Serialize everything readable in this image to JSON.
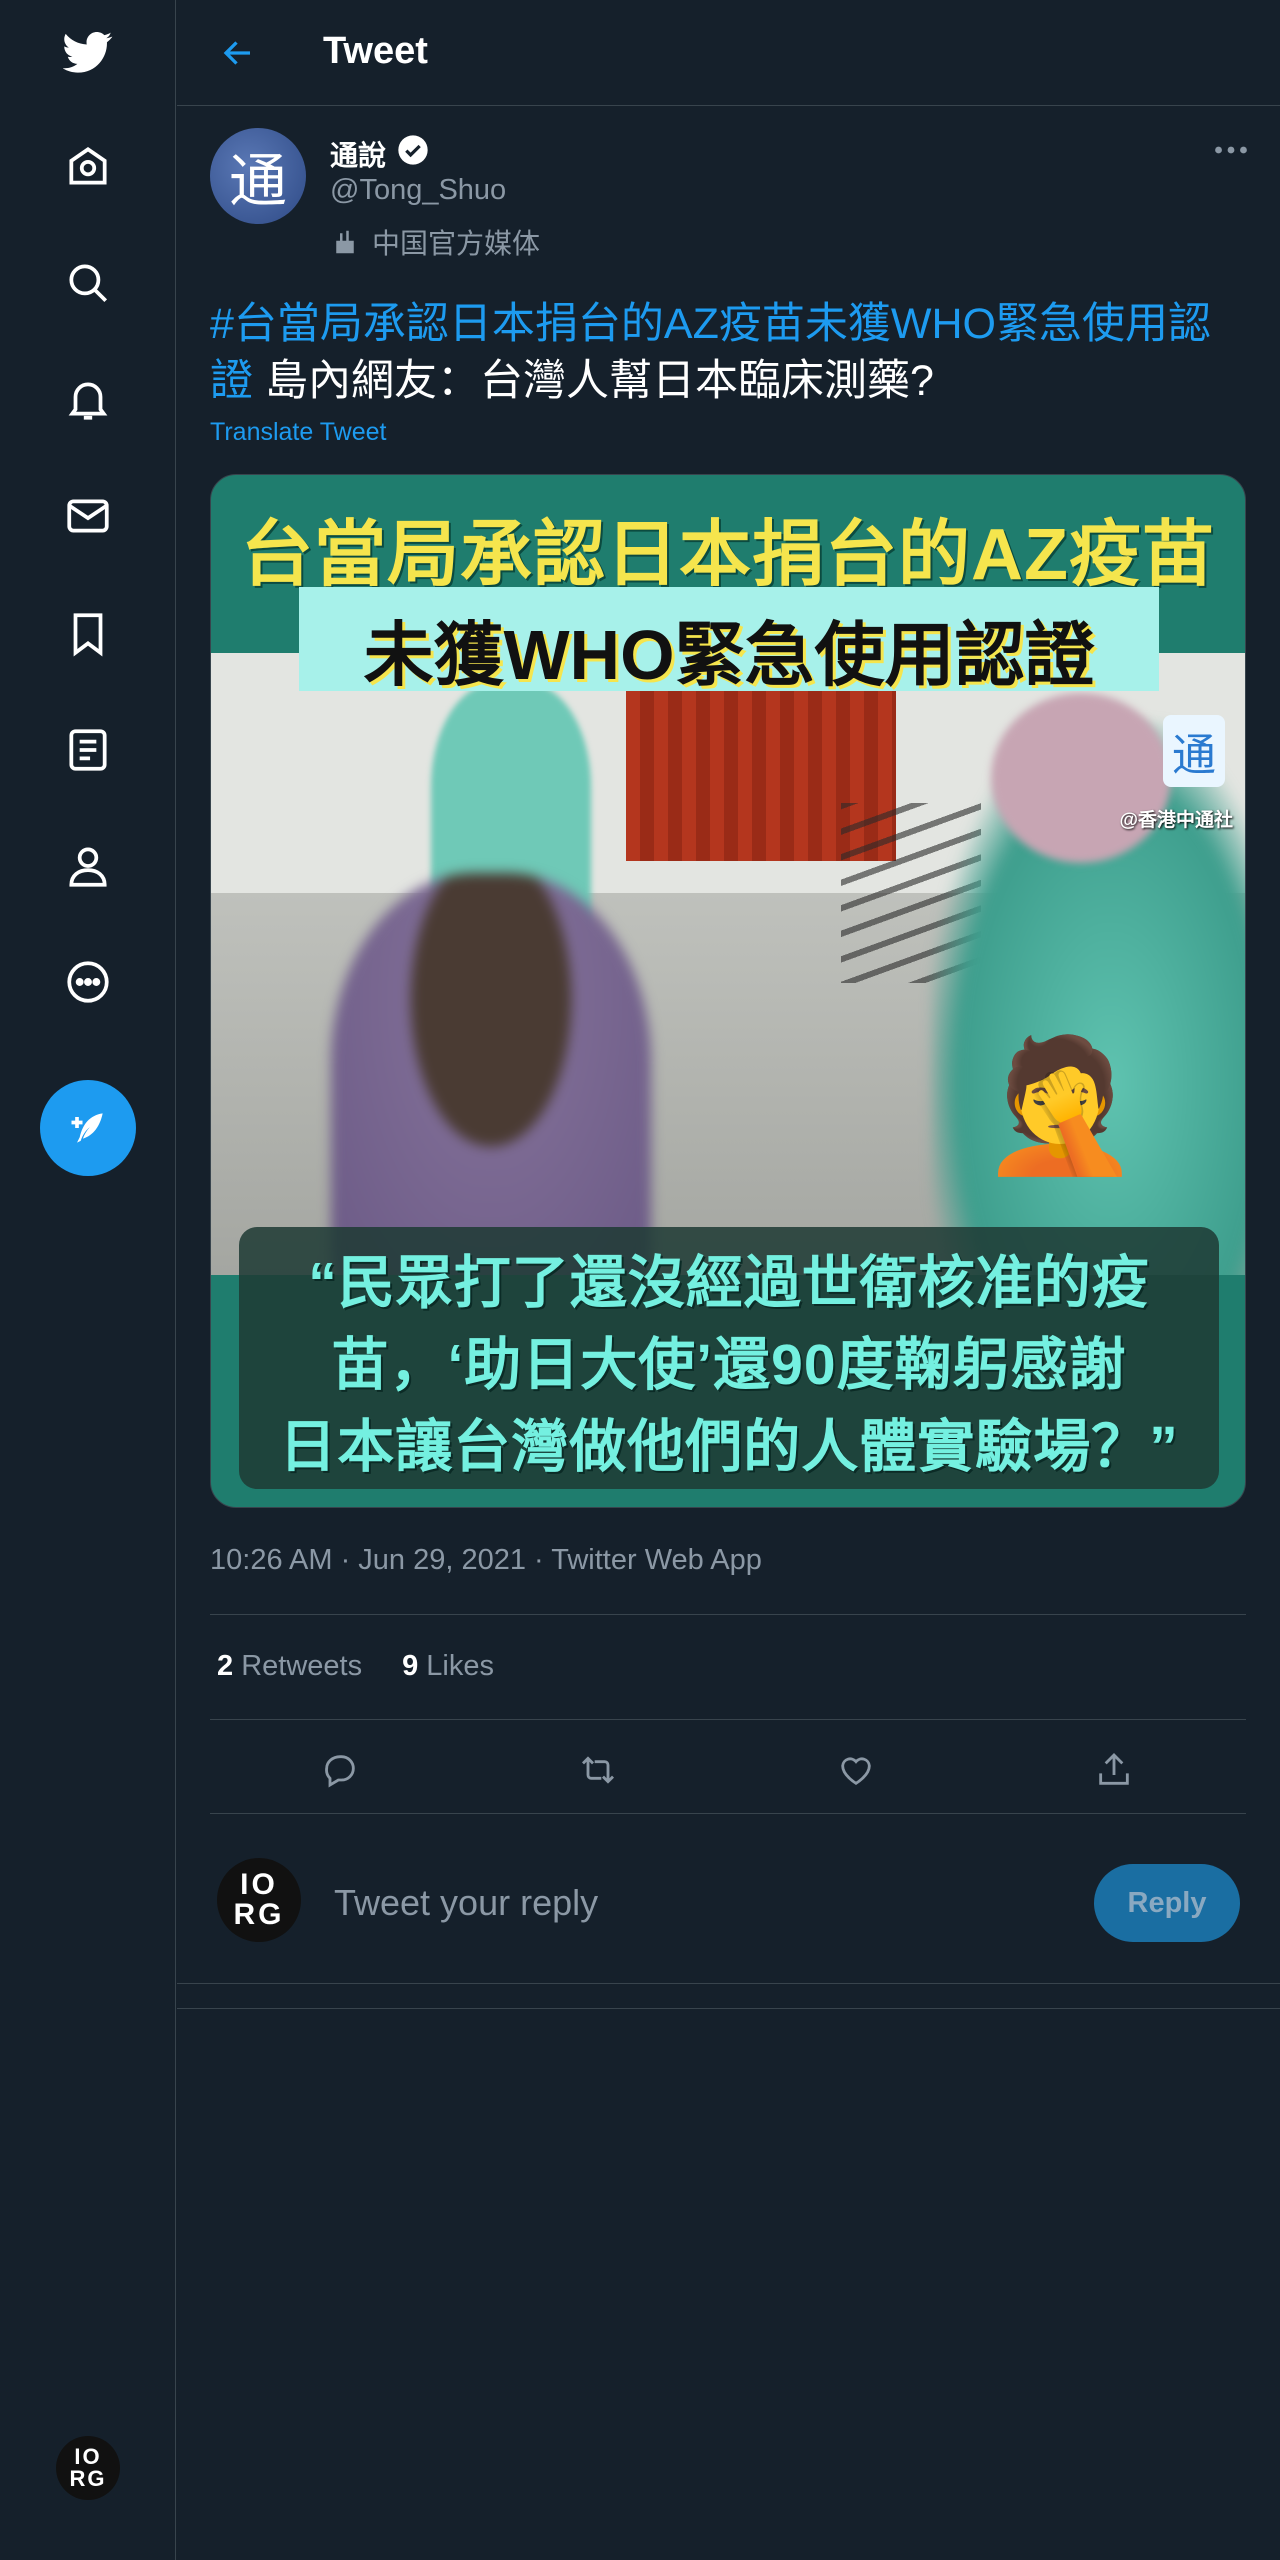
{
  "nav": {
    "items": [
      "twitter-logo",
      "home",
      "explore",
      "notifications",
      "messages",
      "bookmarks",
      "lists",
      "profile",
      "more"
    ],
    "compose_label": "",
    "avatar_text": {
      "line1": "IO",
      "line2": "RG"
    }
  },
  "header": {
    "title": "Tweet"
  },
  "tweet": {
    "author": {
      "name": "通說",
      "handle": "@Tong_Shuo",
      "media_label": "中国官方媒体",
      "avatar_glyph": "通"
    },
    "hashtag": "#台當局承認日本捐台的AZ疫苗未獲WHO緊急使用認證",
    "text": " 島內網友：台灣人幫日本臨床測藥?",
    "translate_label": "Translate Tweet",
    "image": {
      "title_line1": "台當局承認日本捐台的AZ疫苗",
      "title_line2": "未獲WHO緊急使用認證",
      "watermark": "@香港中通社",
      "logo_glyph": "通",
      "emoji": "🤦",
      "quote_line1": "“民眾打了還沒經過世衛核准的疫",
      "quote_line2": "苗，‘助日大使’還90度鞠躬感謝",
      "quote_line3": "日本讓台灣做他們的人體實驗場？”"
    },
    "timestamp": "10:26 AM · Jun 29, 2021 · Twitter Web App",
    "stats": {
      "retweets_count": "2",
      "retweets_label": "Retweets",
      "likes_count": "9",
      "likes_label": "Likes"
    }
  },
  "reply": {
    "avatar_text": {
      "line1": "IO",
      "line2": "RG"
    },
    "placeholder": "Tweet your reply",
    "button_label": "Reply"
  },
  "colors": {
    "background": "#15202b",
    "accent": "#1d9bf0",
    "secondary_text": "#8b98a5",
    "border": "#38444d"
  }
}
